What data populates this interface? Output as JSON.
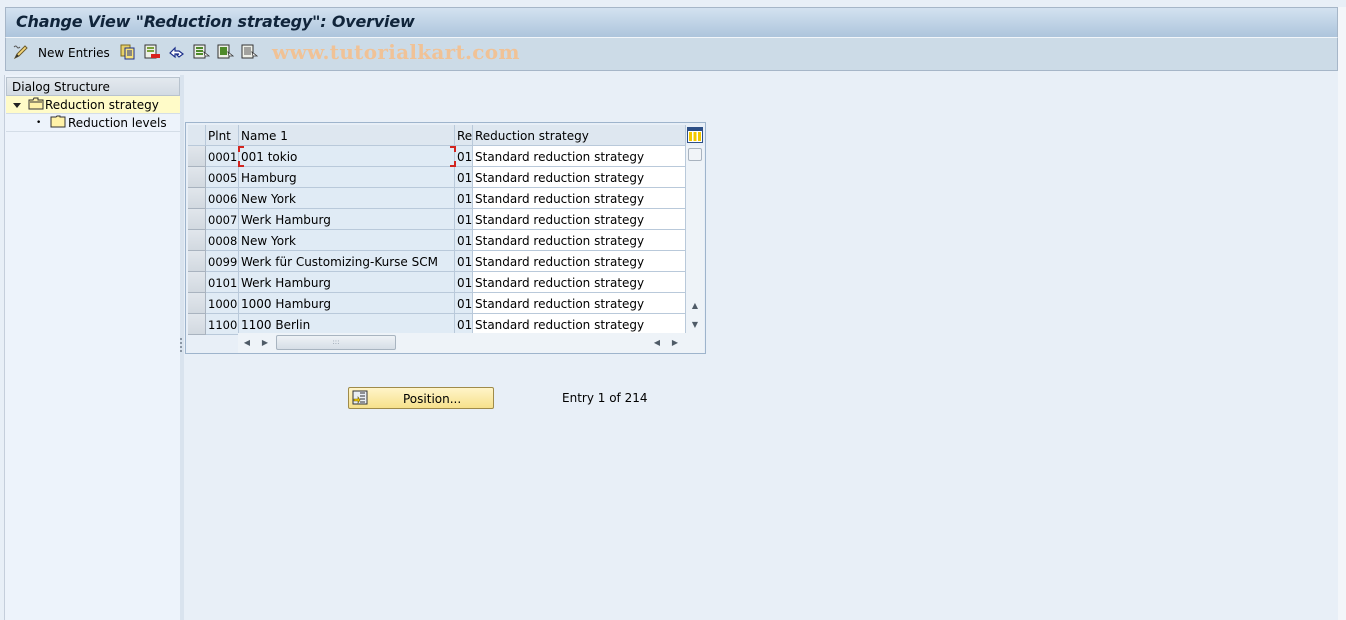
{
  "window": {
    "title": "Change View \"Reduction strategy\": Overview"
  },
  "toolbar": {
    "items": [
      {
        "icon": "edit-pencil-icon",
        "label": "New Entries"
      },
      {
        "icon": "copy-as-icon"
      },
      {
        "icon": "delete-icon"
      },
      {
        "icon": "undo-change-icon"
      },
      {
        "icon": "select-all-icon"
      },
      {
        "icon": "select-block-icon"
      },
      {
        "icon": "deselect-all-icon"
      }
    ],
    "watermark": "www.tutorialkart.com"
  },
  "dialog_structure": {
    "header": "Dialog Structure",
    "items": [
      {
        "label": "Reduction strategy",
        "level": 0,
        "expanded": true,
        "selected": true,
        "icon": "open-folder-icon"
      },
      {
        "label": "Reduction levels",
        "level": 1,
        "expanded": false,
        "selected": false,
        "icon": "folder-icon"
      }
    ]
  },
  "table": {
    "columns": [
      "Plnt",
      "Name 1",
      "Re",
      "Reduction strategy"
    ],
    "rows": [
      {
        "plnt": "0001",
        "name": "001 tokio",
        "re": "01",
        "strategy": "Standard reduction strategy"
      },
      {
        "plnt": "0005",
        "name": "Hamburg",
        "re": "01",
        "strategy": "Standard reduction strategy"
      },
      {
        "plnt": "0006",
        "name": "New York",
        "re": "01",
        "strategy": "Standard reduction strategy"
      },
      {
        "plnt": "0007",
        "name": "Werk Hamburg",
        "re": "01",
        "strategy": "Standard reduction strategy"
      },
      {
        "plnt": "0008",
        "name": "New York",
        "re": "01",
        "strategy": "Standard reduction strategy"
      },
      {
        "plnt": "0099",
        "name": "Werk für Customizing-Kurse SCM",
        "re": "01",
        "strategy": "Standard reduction strategy"
      },
      {
        "plnt": "0101",
        "name": "Werk Hamburg",
        "re": "01",
        "strategy": "Standard reduction strategy"
      },
      {
        "plnt": "1000",
        "name": "1000 Hamburg",
        "re": "01",
        "strategy": "Standard reduction strategy"
      },
      {
        "plnt": "1100",
        "name": "1100 Berlin",
        "re": "01",
        "strategy": "Standard reduction strategy"
      }
    ],
    "column_settings_icon": "table-settings-icon"
  },
  "footer": {
    "position_button": "Position...",
    "entry_info": "Entry 1 of 214"
  }
}
